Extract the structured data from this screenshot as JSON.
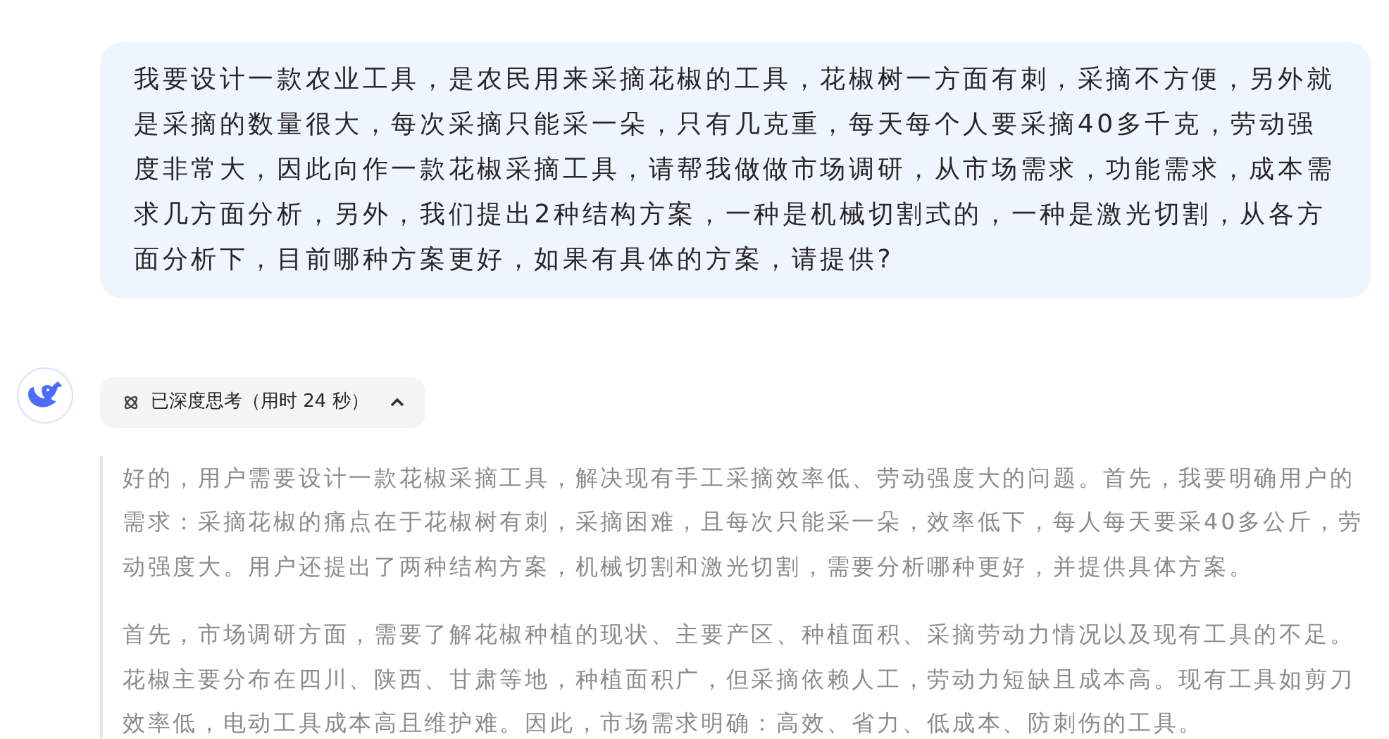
{
  "user_message": "我要设计一款农业工具，是农民用来采摘花椒的工具，花椒树一方面有刺，采摘不方便，另外就是采摘的数量很大，每次采摘只能采一朵，只有几克重，每天每个人要采摘40多千克，劳动强度非常大，因此向作一款花椒采摘工具，请帮我做做市场调研，从市场需求，功能需求，成本需求几方面分析，另外，我们提出2种结构方案，一种是机械切割式的，一种是激光切割，从各方面分析下，目前哪种方案更好，如果有具体的方案，请提供?",
  "thinking": {
    "label": "已深度思考（用时 24 秒）",
    "expanded": true,
    "paragraphs": [
      "好的，用户需要设计一款花椒采摘工具，解决现有手工采摘效率低、劳动强度大的问题。首先，我要明确用户的需求：采摘花椒的痛点在于花椒树有刺，采摘困难，且每次只能采一朵，效率低下，每人每天要采40多公斤，劳动强度大。用户还提出了两种结构方案，机械切割和激光切割，需要分析哪种更好，并提供具体方案。",
      "首先，市场调研方面，需要了解花椒种植的现状、主要产区、种植面积、采摘劳动力情况以及现有工具的不足。花椒主要分布在四川、陕西、甘肃等地，种植面积广，但采摘依赖人工，劳动力短缺且成本高。现有工具如剪刀效率低，电动工具成本高且维护难。因此，市场需求明确：高效、省力、低成本、防刺伤的工具。"
    ]
  }
}
